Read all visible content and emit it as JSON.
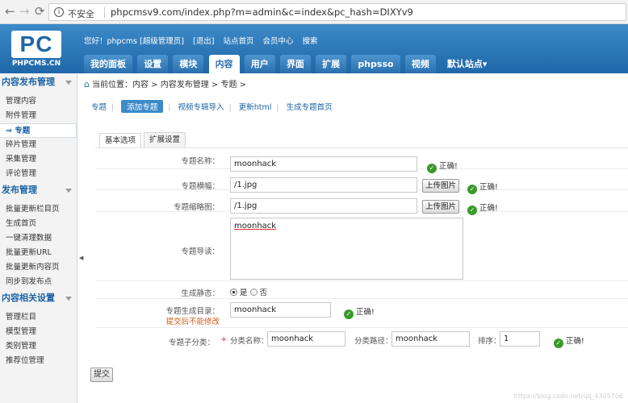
{
  "browser": {
    "back_icon": "←",
    "forward_icon": "→",
    "reload_icon": "⟳",
    "info_icon": "i",
    "security_label": "不安全",
    "url": "phpcmsv9.com/index.php?m=admin&c=index&pc_hash=DIXYv9"
  },
  "logo": {
    "mark": "PC",
    "subtitle": "PHPCMS.CN"
  },
  "top_links": [
    "您好！phpcms [超级管理员]",
    "[退出]",
    "站点首页",
    "会员中心",
    "搜索"
  ],
  "nav_tabs": [
    "我的面板",
    "设置",
    "模块",
    "内容",
    "用户",
    "界面",
    "扩展",
    "phpsso",
    "视频",
    "默认站点▾"
  ],
  "nav_active_index": 3,
  "sidebar": {
    "group1": {
      "title": "内容发布管理",
      "items": [
        "管理内容",
        "附件管理",
        "⇒ 专题",
        "碎片管理",
        "采集管理",
        "评论管理"
      ]
    },
    "group2": {
      "title": "发布管理",
      "items": [
        "批量更新栏目页",
        "生成首页",
        "一键清理数据",
        "批量更新URL",
        "批量更新内容页",
        "同步到发布点"
      ]
    },
    "group3": {
      "title": "内容相关设置",
      "items": [
        "管理栏目",
        "模型管理",
        "类别管理",
        "推荐位管理"
      ]
    },
    "collapse_icon": "◀"
  },
  "breadcrumb": {
    "home_icon": "⌂",
    "text": "当前位置：内容 > 内容发布管理 > 专题 >"
  },
  "subnav": [
    "专题",
    "添加专题",
    "视频专辑导入",
    "更新html",
    "生成专题首页"
  ],
  "form_tabs": [
    "基本选项",
    "扩展设置"
  ],
  "form": {
    "name": {
      "label": "专题名称：",
      "value": "moonhack",
      "status": "正确!"
    },
    "banner": {
      "label": "专题横幅：",
      "value": "/1.jpg",
      "button": "上传图片",
      "status": "正确!"
    },
    "thumb": {
      "label": "专题缩略图：",
      "value": "/1.jpg",
      "button": "上传图片",
      "status": "正确!"
    },
    "desc": {
      "label": "专题导读：",
      "value": "moonhack"
    },
    "static": {
      "label": "生成静态：",
      "yes": "是",
      "no": "否"
    },
    "dir": {
      "label": "专题生成目录：",
      "note": "提交后不能修改",
      "value": "moonhack",
      "status": "正确!"
    },
    "subcat": {
      "label": "专题子分类：",
      "required": "+",
      "name_label": "分类名称：",
      "name_value": "moonhack",
      "path_label": "分类路径：",
      "path_value": "moonhack",
      "order_label": "排序：",
      "order_value": "1",
      "status": "正确!"
    }
  },
  "submit_label": "提交",
  "ok_icon": "✓",
  "watermark": "https://blog.csdn.net/qq_4305706"
}
